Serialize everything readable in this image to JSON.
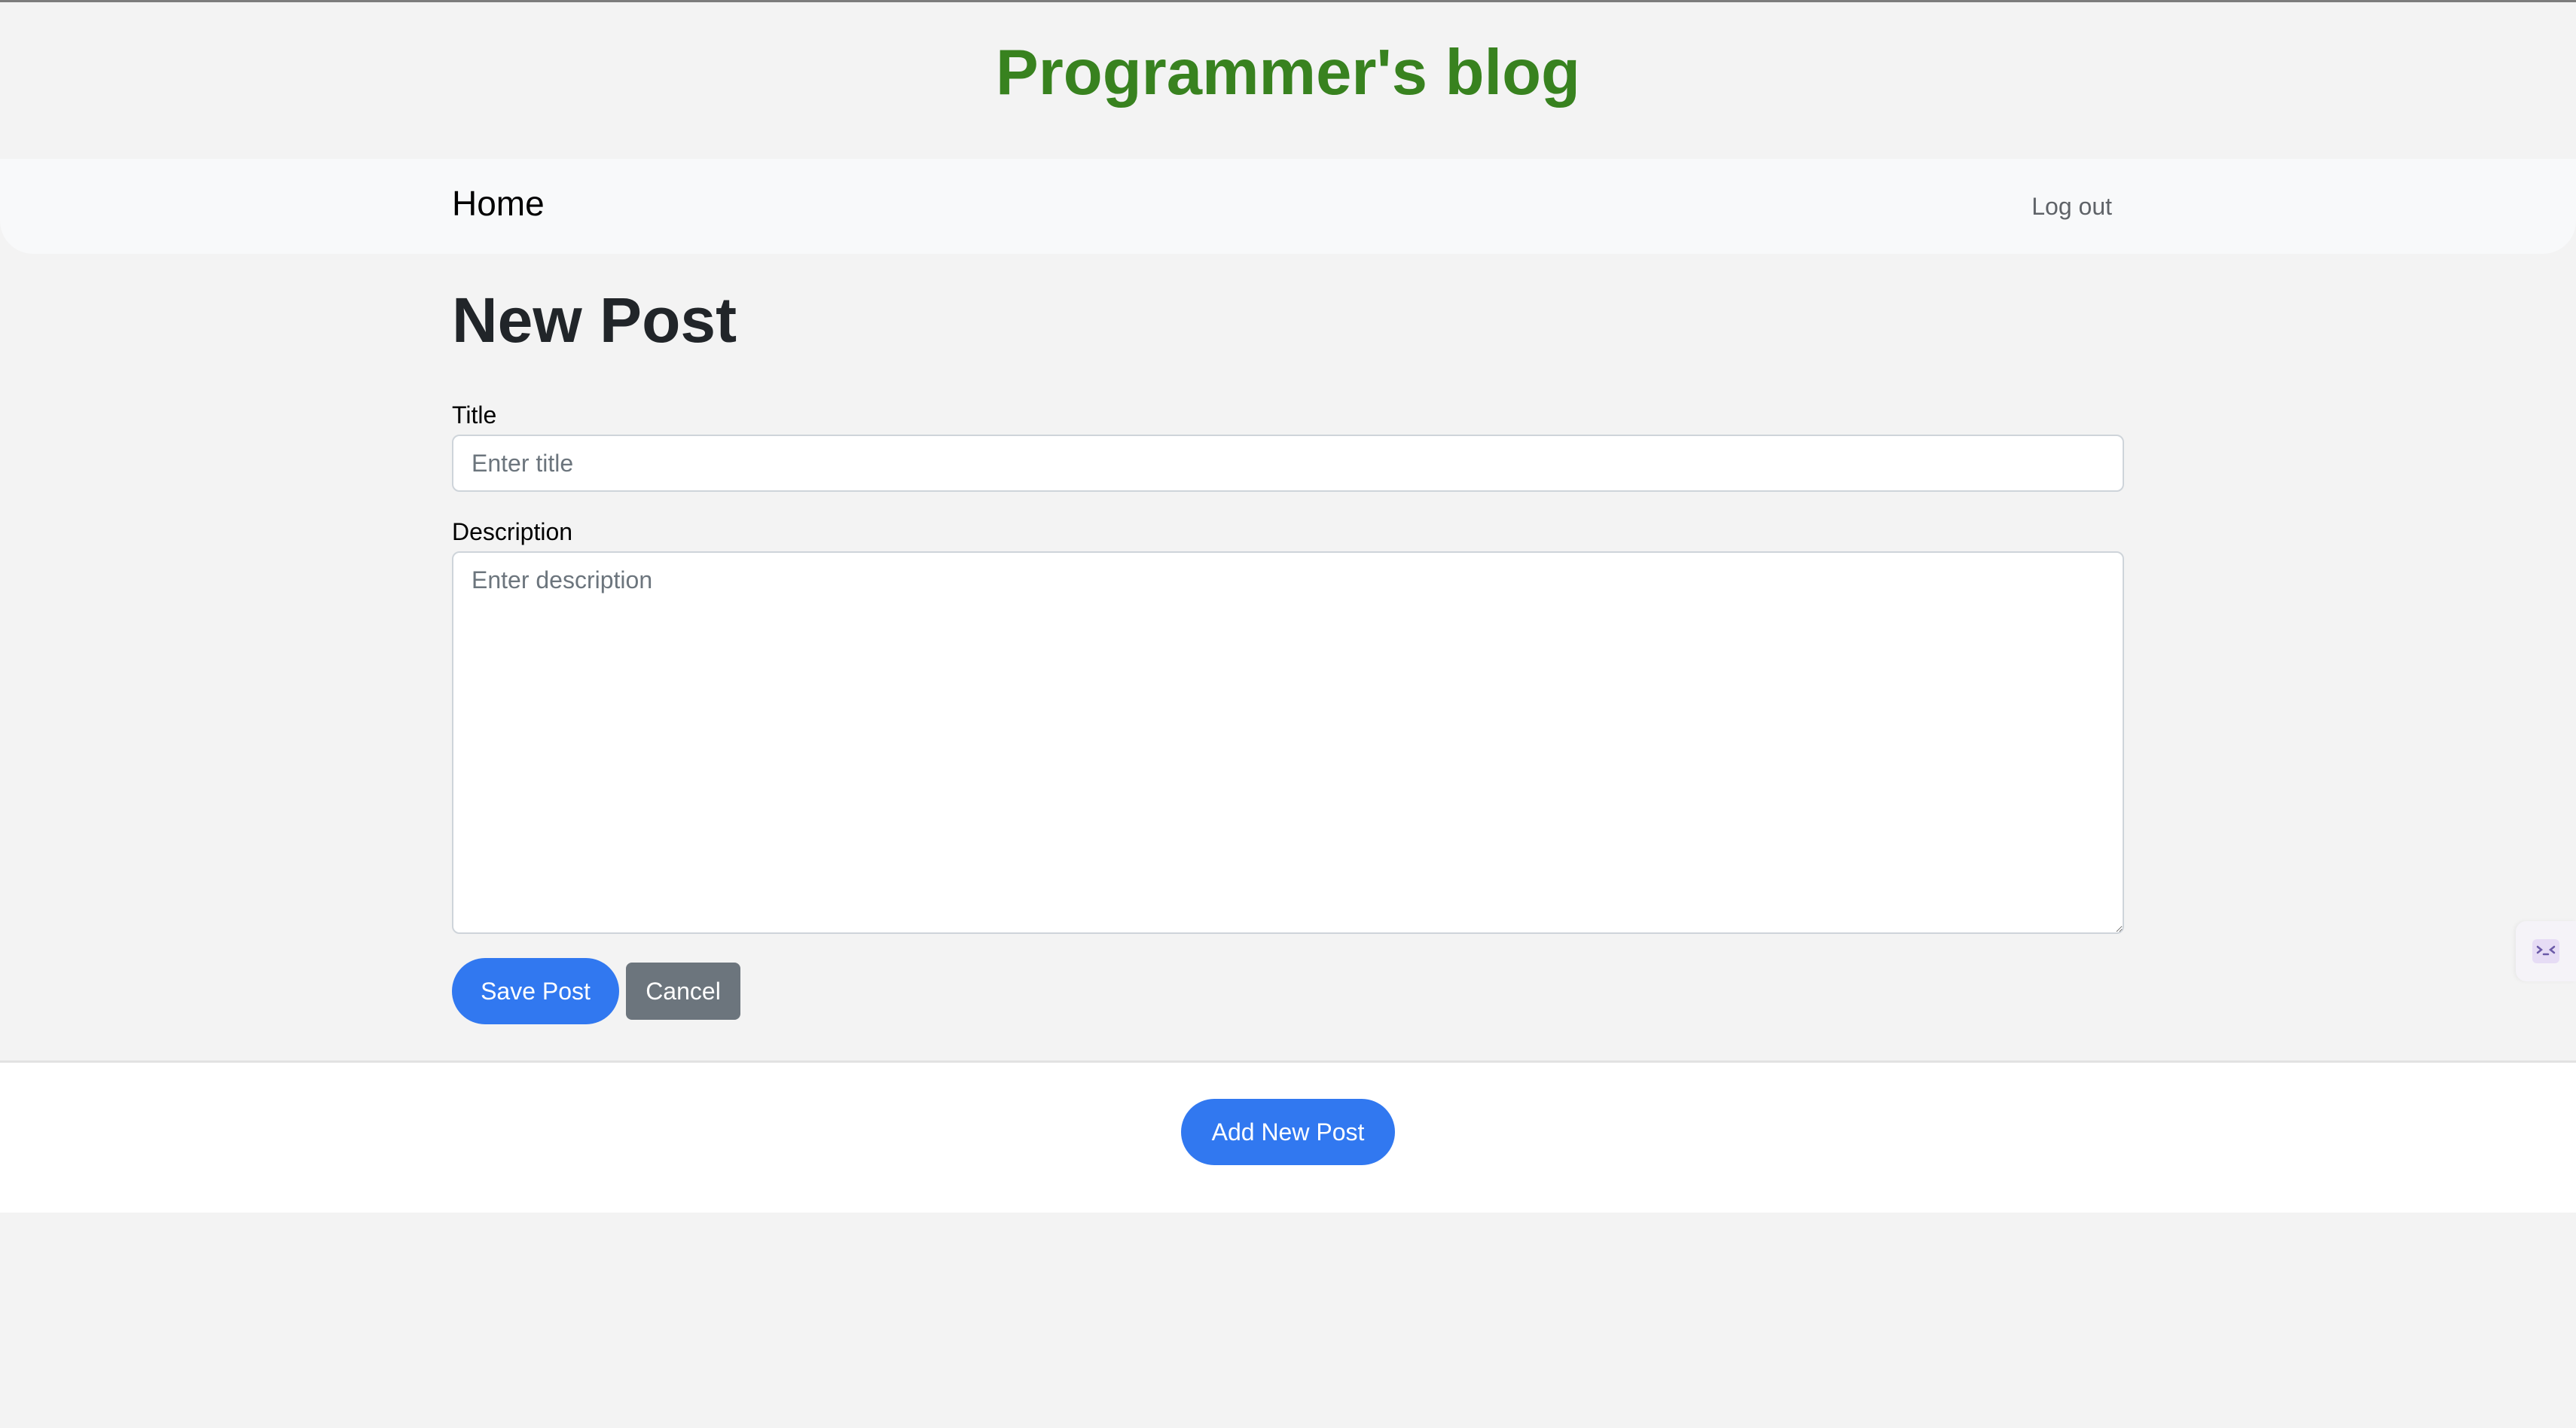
{
  "header": {
    "site_title": "Programmer's blog"
  },
  "nav": {
    "home_label": "Home",
    "logout_label": "Log out"
  },
  "main": {
    "heading": "New Post",
    "form": {
      "title_label": "Title",
      "title_placeholder": "Enter title",
      "title_value": "",
      "description_label": "Description",
      "description_placeholder": "Enter description",
      "description_value": "",
      "save_label": "Save Post",
      "cancel_label": "Cancel"
    }
  },
  "footer": {
    "add_label": "Add New Post"
  },
  "widget": {
    "icon": "assistant-widget-icon"
  },
  "colors": {
    "brand_title": "#38821f",
    "primary": "#3178f0",
    "secondary": "#6c757d"
  }
}
